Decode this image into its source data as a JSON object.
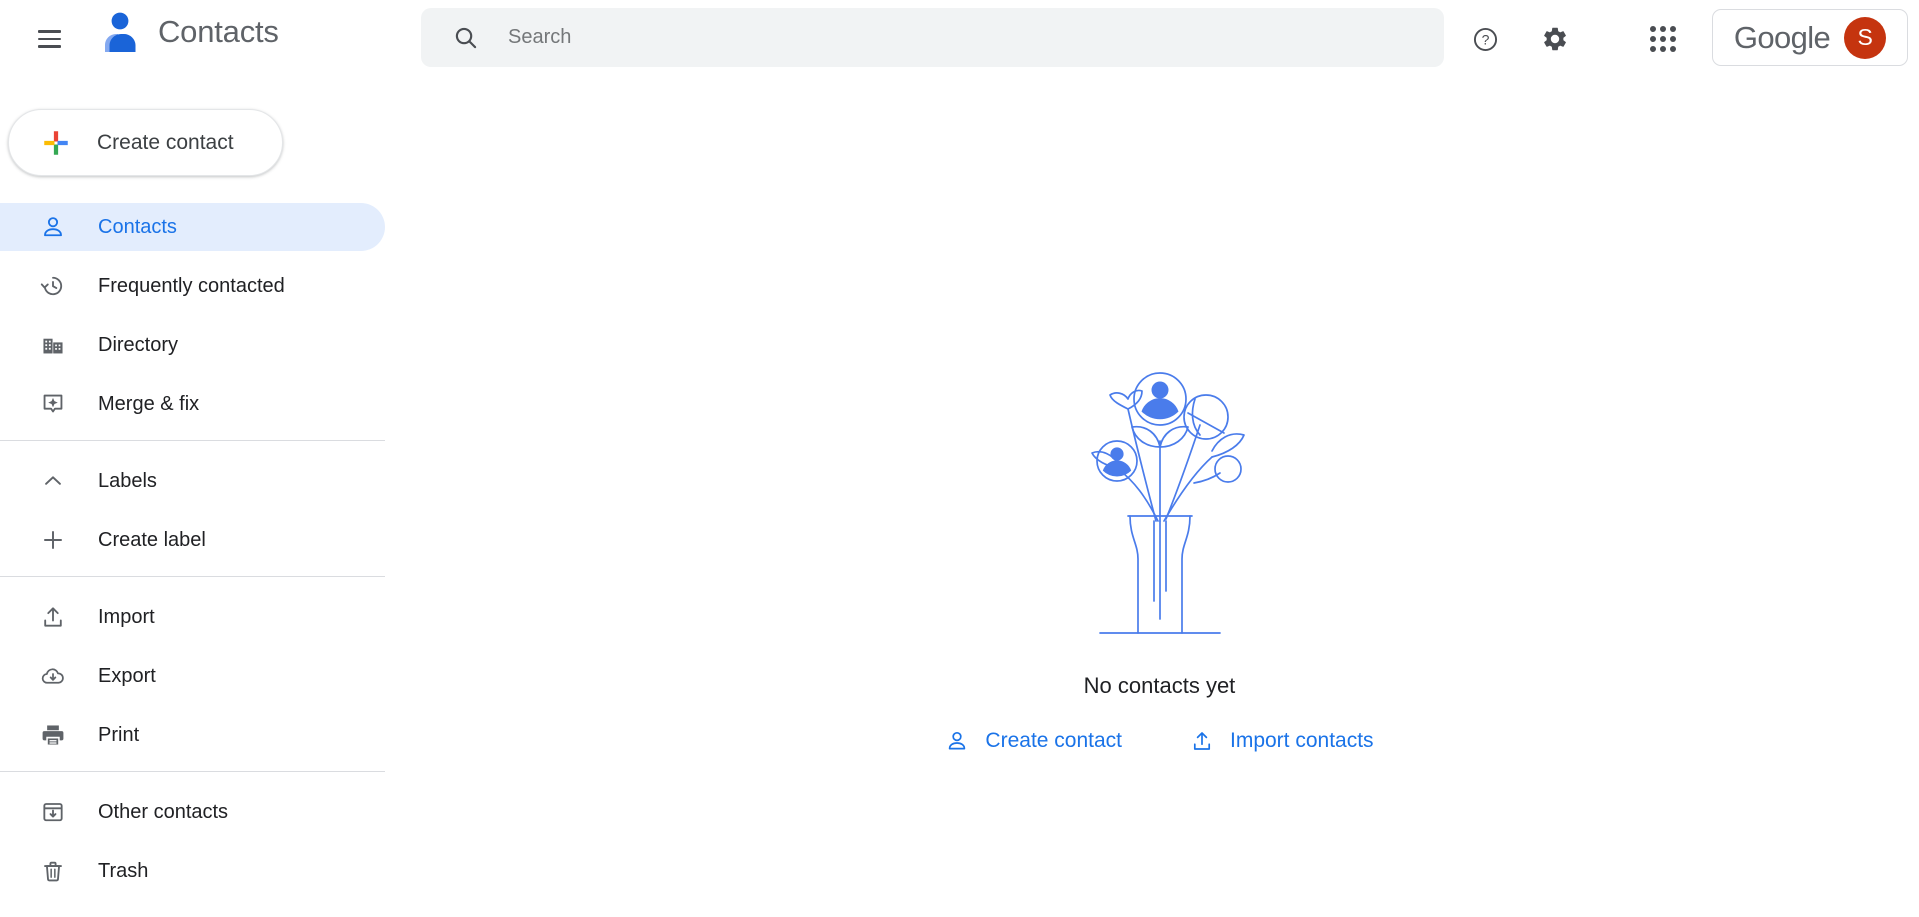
{
  "app": {
    "title": "Contacts",
    "logo_icon": "contacts-person-logo",
    "menu_icon": "hamburger-menu-icon"
  },
  "search": {
    "placeholder": "Search",
    "value": "",
    "icon": "search-icon"
  },
  "topbar": {
    "help_icon": "help-circle-icon",
    "settings_icon": "gear-icon",
    "apps_icon": "apps-grid-icon",
    "account": {
      "brand_word": "Google",
      "avatar_initial": "S",
      "avatar_color": "#c5340f"
    }
  },
  "sidebar": {
    "create_button": {
      "label": "Create contact",
      "icon": "google-plus-icon"
    },
    "groups": [
      {
        "items": [
          {
            "label": "Contacts",
            "icon": "person-icon",
            "active": true
          },
          {
            "label": "Frequently contacted",
            "icon": "history-clock-icon",
            "active": false
          },
          {
            "label": "Directory",
            "icon": "building-icon",
            "active": false
          },
          {
            "label": "Merge & fix",
            "icon": "merge-sparkle-icon",
            "active": false
          }
        ]
      },
      {
        "items": [
          {
            "label": "Labels",
            "icon": "chevron-up-icon",
            "active": false
          },
          {
            "label": "Create label",
            "icon": "plus-icon",
            "active": false
          }
        ]
      },
      {
        "items": [
          {
            "label": "Import",
            "icon": "upload-icon",
            "active": false
          },
          {
            "label": "Export",
            "icon": "cloud-download-icon",
            "active": false
          },
          {
            "label": "Print",
            "icon": "printer-icon",
            "active": false
          }
        ]
      },
      {
        "items": [
          {
            "label": "Other contacts",
            "icon": "archive-down-icon",
            "active": false
          },
          {
            "label": "Trash",
            "icon": "trash-icon",
            "active": false
          }
        ]
      }
    ]
  },
  "main": {
    "empty_state": {
      "illustration": "flower-vase-contacts-illustration",
      "illustration_color": "#4a7ceb",
      "title": "No contacts yet",
      "actions": [
        {
          "label": "Create contact",
          "icon": "person-add-icon"
        },
        {
          "label": "Import contacts",
          "icon": "upload-icon"
        }
      ]
    }
  },
  "colors": {
    "accent_blue": "#1a73e8",
    "active_pill": "#e3edfd",
    "search_bg": "#f1f3f4",
    "text_primary": "#202124",
    "text_secondary": "#5f6368",
    "divider": "#dadce0"
  }
}
